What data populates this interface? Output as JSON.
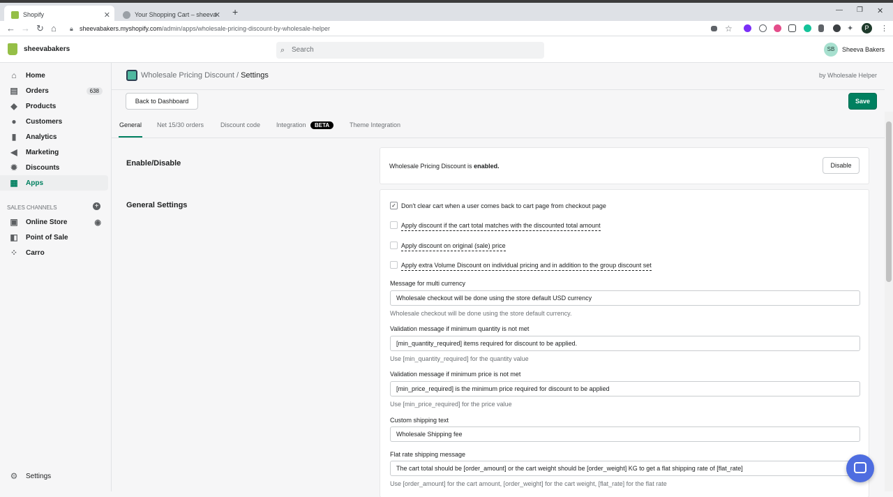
{
  "browser": {
    "tabs": [
      {
        "title": "Shopify"
      },
      {
        "title": "Your Shopping Cart – sheevabak"
      }
    ],
    "url_domain": "sheevabakers.myshopify.com",
    "url_path": "/admin/apps/wholesale-pricing-discount-by-wholesale-helper",
    "profile_initial": "P"
  },
  "shop": {
    "name": "sheevabakers",
    "search_placeholder": "Search",
    "user_initials": "SB",
    "user_name": "Sheeva Bakers"
  },
  "sidebar": {
    "items": [
      {
        "label": "Home",
        "icon": "home-icon"
      },
      {
        "label": "Orders",
        "icon": "orders-icon",
        "badge": "638"
      },
      {
        "label": "Products",
        "icon": "tag-icon"
      },
      {
        "label": "Customers",
        "icon": "person-icon"
      },
      {
        "label": "Analytics",
        "icon": "bar-chart-icon"
      },
      {
        "label": "Marketing",
        "icon": "megaphone-icon"
      },
      {
        "label": "Discounts",
        "icon": "discount-icon"
      },
      {
        "label": "Apps",
        "icon": "apps-icon"
      }
    ],
    "sales_channels_heading": "SALES CHANNELS",
    "channels": [
      {
        "label": "Online Store",
        "icon": "store-icon"
      },
      {
        "label": "Point of Sale",
        "icon": "pos-icon"
      },
      {
        "label": "Carro",
        "icon": "carro-icon"
      }
    ],
    "settings_label": "Settings"
  },
  "page": {
    "breadcrumb_app": "Wholesale Pricing Discount",
    "breadcrumb_sep": "/",
    "breadcrumb_current": "Settings",
    "by_line": "by Wholesale Helper",
    "back_button": "Back to Dashboard",
    "save_button": "Save",
    "tabs": [
      {
        "label": "General"
      },
      {
        "label": "Net 15/30 orders"
      },
      {
        "label": "Discount code"
      },
      {
        "label": "Integration"
      },
      {
        "label": "Theme Integration"
      }
    ],
    "beta_badge": "BETA",
    "accent_color": "#008060"
  },
  "enable_section": {
    "title": "Enable/Disable",
    "status_prefix": "Wholesale Pricing Discount is",
    "status_value": "enabled.",
    "disable_button": "Disable"
  },
  "general_settings": {
    "title": "General Settings",
    "checkboxes": [
      {
        "label": "Don't clear cart when a user comes back to cart page from checkout page",
        "checked": true
      },
      {
        "label": "Apply discount if the cart total matches with the discounted total amount",
        "checked": false
      },
      {
        "label": "Apply discount on original (sale) price",
        "checked": false
      },
      {
        "label": "Apply extra Volume Discount on individual pricing and in addition to the group discount set",
        "checked": false
      }
    ],
    "fields": [
      {
        "label": "Message for multi currency",
        "value": "Wholesale checkout will be done using the store default USD currency",
        "help": "Wholesale checkout will be done using the store default currency."
      },
      {
        "label": "Validation message if minimum quantity is not met",
        "value": "[min_quantity_required] items required for discount to be applied.",
        "help": "Use [min_quantity_required] for the quantity value"
      },
      {
        "label": "Validation message if minimum price is not met",
        "value": "[min_price_required] is the minimum price required for discount to be applied",
        "help": "Use [min_price_required] for the price value"
      },
      {
        "label": "Custom shipping text",
        "value": "Wholesale Shipping fee",
        "help": ""
      },
      {
        "label": "Flat rate shipping message",
        "value": "The cart total should be [order_amount] or the cart weight should be [order_weight] KG to get a flat shipping rate of [flat_rate]",
        "help": "Use [order_amount] for the cart amount, [order_weight] for the cart weight, [flat_rate] for the flat rate"
      }
    ]
  }
}
